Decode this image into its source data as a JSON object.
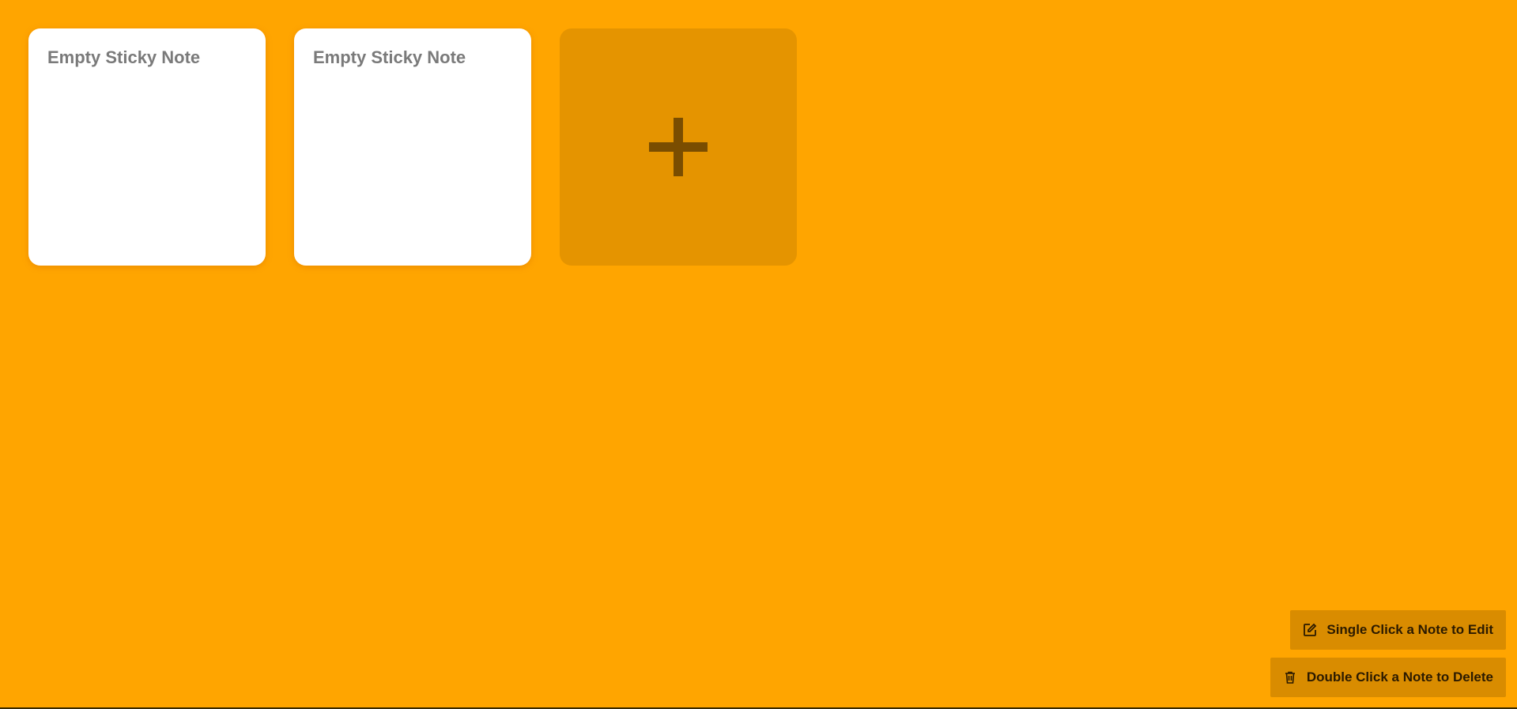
{
  "notes": [
    {
      "text": "Empty Sticky Note"
    },
    {
      "text": "Empty Sticky Note"
    }
  ],
  "add_button": {
    "icon": "plus-icon"
  },
  "hints": {
    "edit": {
      "label": "Single Click a Note to Edit",
      "icon": "edit-icon"
    },
    "delete": {
      "label": "Double Click a Note to Delete",
      "icon": "trash-icon"
    }
  },
  "colors": {
    "background": "#FFA500",
    "note": "#FFFFFF",
    "note_text": "#7A7A7A",
    "add_tile": "#E59400",
    "add_icon": "#7A4D00",
    "hint_bg": "#D98C00",
    "hint_text": "#2B1A00"
  }
}
